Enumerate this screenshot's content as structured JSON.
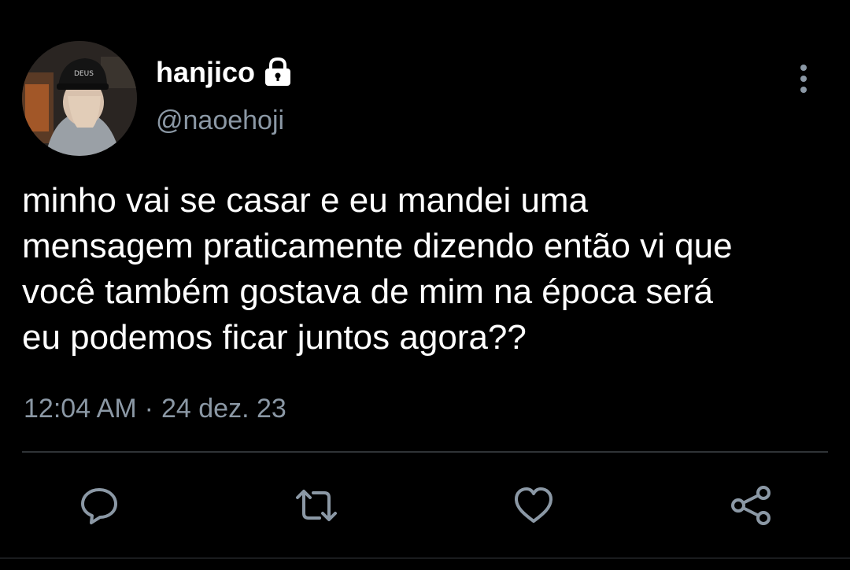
{
  "user": {
    "display_name": "hanjico",
    "handle": "@naoehoji"
  },
  "tweet": {
    "text": "minho vai se casar e eu mandei uma\nmensagem praticamente dizendo então vi que\nvocê também gostava de mim na época será\neu podemos ficar juntos agora??",
    "time": "12:04 AM",
    "separator": "·",
    "date": "24 dez. 23"
  },
  "icons": {
    "lock": "lock-icon",
    "more": "more-vertical-icon",
    "reply": "reply-icon",
    "retweet": "retweet-icon",
    "like": "heart-icon",
    "share": "share-icon"
  },
  "colors": {
    "background": "#000000",
    "text": "#ffffff",
    "secondary": "#8b98a5",
    "divider": "#2f3336"
  }
}
